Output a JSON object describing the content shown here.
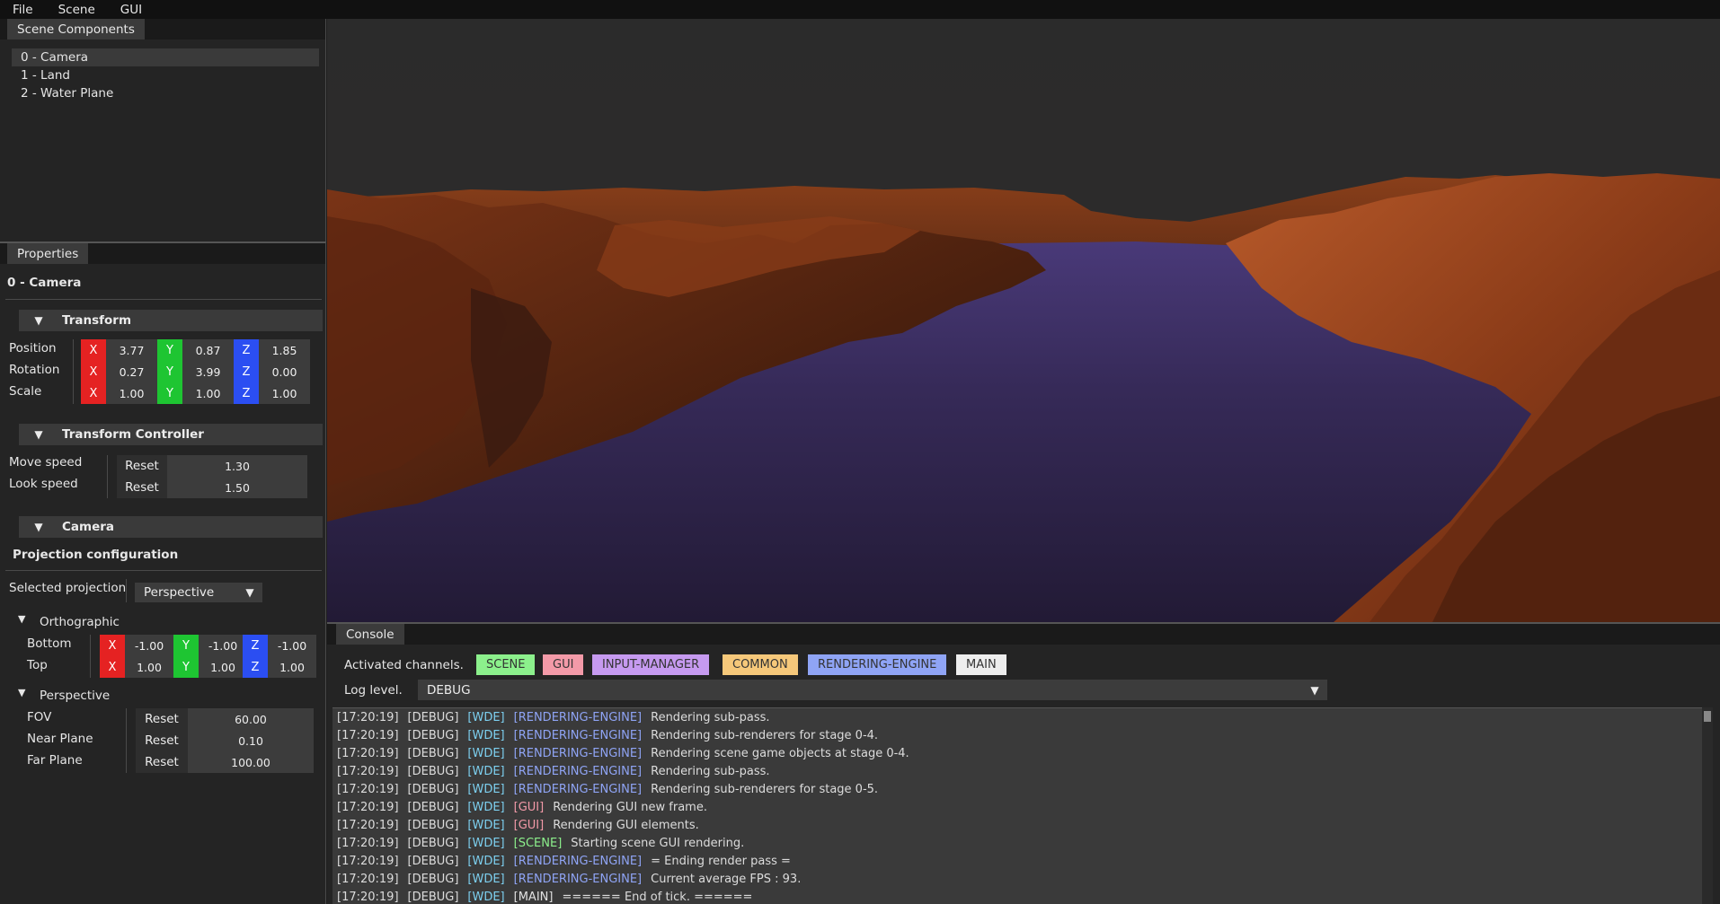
{
  "menu": [
    "File",
    "Scene",
    "GUI"
  ],
  "scene_panel": {
    "tab": "Scene Components",
    "items": [
      "0 - Camera",
      "1 - Land",
      "2 - Water Plane"
    ],
    "selected_index": 0
  },
  "properties": {
    "tab": "Properties",
    "object_name": "0 - Camera",
    "transform": {
      "header": "Transform",
      "rows": [
        {
          "label": "Position",
          "x": "3.77",
          "y": "0.87",
          "z": "1.85"
        },
        {
          "label": "Rotation",
          "x": "0.27",
          "y": "3.99",
          "z": "0.00"
        },
        {
          "label": "Scale",
          "x": "1.00",
          "y": "1.00",
          "z": "1.00"
        }
      ],
      "axis_labels": {
        "x": "X",
        "y": "Y",
        "z": "Z"
      }
    },
    "controller": {
      "header": "Transform Controller",
      "rows": [
        {
          "label": "Move speed",
          "reset": "Reset",
          "value": "1.30"
        },
        {
          "label": "Look speed",
          "reset": "Reset",
          "value": "1.50"
        }
      ]
    },
    "camera": {
      "header": "Camera",
      "projection_config": "Projection configuration",
      "selected_projection_label": "Selected projection",
      "selected_projection": "Perspective",
      "orthographic": {
        "header": "Orthographic",
        "rows": [
          {
            "label": "Bottom",
            "x": "-1.00",
            "y": "-1.00",
            "z": "-1.00"
          },
          {
            "label": "Top",
            "x": "1.00",
            "y": "1.00",
            "z": "1.00"
          }
        ]
      },
      "perspective": {
        "header": "Perspective",
        "rows": [
          {
            "label": "FOV",
            "reset": "Reset",
            "value": "60.00"
          },
          {
            "label": "Near Plane",
            "reset": "Reset",
            "value": "0.10"
          },
          {
            "label": "Far Plane",
            "reset": "Reset",
            "value": "100.00"
          }
        ]
      }
    }
  },
  "console": {
    "tab": "Console",
    "channels_label": "Activated channels.",
    "channels": [
      {
        "name": "SCENE",
        "bg": "#8cf08c"
      },
      {
        "name": "GUI",
        "bg": "#f39aa8"
      },
      {
        "name": "INPUT-MANAGER",
        "bg": "#c69af0"
      },
      {
        "name": "COMMON",
        "bg": "#f6c87a"
      },
      {
        "name": "RENDERING-ENGINE",
        "bg": "#8fa4f5"
      },
      {
        "name": "MAIN",
        "bg": "#eeeeee"
      }
    ],
    "log_level_label": "Log level.",
    "log_level": "DEBUG",
    "channel_colors": {
      "RENDERING-ENGINE": "#8fa4f5",
      "GUI": "#f39aa8",
      "SCENE": "#8cf08c",
      "MAIN": "#e0e0e0"
    },
    "lines": [
      {
        "time": "[17:20:19]",
        "level": "[DEBUG]",
        "src": "[WDE]",
        "channel": "RENDERING-ENGINE",
        "channel_text": "[RENDERING-ENGINE]",
        "msg": "Rendering sub-pass."
      },
      {
        "time": "[17:20:19]",
        "level": "[DEBUG]",
        "src": "[WDE]",
        "channel": "RENDERING-ENGINE",
        "channel_text": "[RENDERING-ENGINE]",
        "msg": "Rendering sub-renderers for stage 0-4."
      },
      {
        "time": "[17:20:19]",
        "level": "[DEBUG]",
        "src": "[WDE]",
        "channel": "RENDERING-ENGINE",
        "channel_text": "[RENDERING-ENGINE]",
        "msg": "Rendering scene game objects at stage 0-4."
      },
      {
        "time": "[17:20:19]",
        "level": "[DEBUG]",
        "src": "[WDE]",
        "channel": "RENDERING-ENGINE",
        "channel_text": "[RENDERING-ENGINE]",
        "msg": "Rendering sub-pass."
      },
      {
        "time": "[17:20:19]",
        "level": "[DEBUG]",
        "src": "[WDE]",
        "channel": "RENDERING-ENGINE",
        "channel_text": "[RENDERING-ENGINE]",
        "msg": "Rendering sub-renderers for stage 0-5."
      },
      {
        "time": "[17:20:19]",
        "level": "[DEBUG]",
        "src": "[WDE]",
        "channel": "GUI",
        "channel_text": "[GUI]",
        "msg": "Rendering GUI new frame."
      },
      {
        "time": "[17:20:19]",
        "level": "[DEBUG]",
        "src": "[WDE]",
        "channel": "GUI",
        "channel_text": "[GUI]",
        "msg": "Rendering GUI elements."
      },
      {
        "time": "[17:20:19]",
        "level": "[DEBUG]",
        "src": "[WDE]",
        "channel": "SCENE",
        "channel_text": "[SCENE]",
        "msg": "Starting scene GUI rendering."
      },
      {
        "time": "[17:20:19]",
        "level": "[DEBUG]",
        "src": "[WDE]",
        "channel": "RENDERING-ENGINE",
        "channel_text": "[RENDERING-ENGINE]",
        "msg": "= Ending render pass ="
      },
      {
        "time": "[17:20:19]",
        "level": "[DEBUG]",
        "src": "[WDE]",
        "channel": "RENDERING-ENGINE",
        "channel_text": "[RENDERING-ENGINE]",
        "msg": "Current average FPS : 93."
      },
      {
        "time": "[17:20:19]",
        "level": "[DEBUG]",
        "src": "[WDE]",
        "channel": "MAIN",
        "channel_text": "[MAIN]",
        "msg": "====== End of tick. ======"
      }
    ]
  },
  "colors": {
    "terrain": "#8a3a18",
    "water": "#3a3068",
    "sky": "#2b2b2b"
  }
}
